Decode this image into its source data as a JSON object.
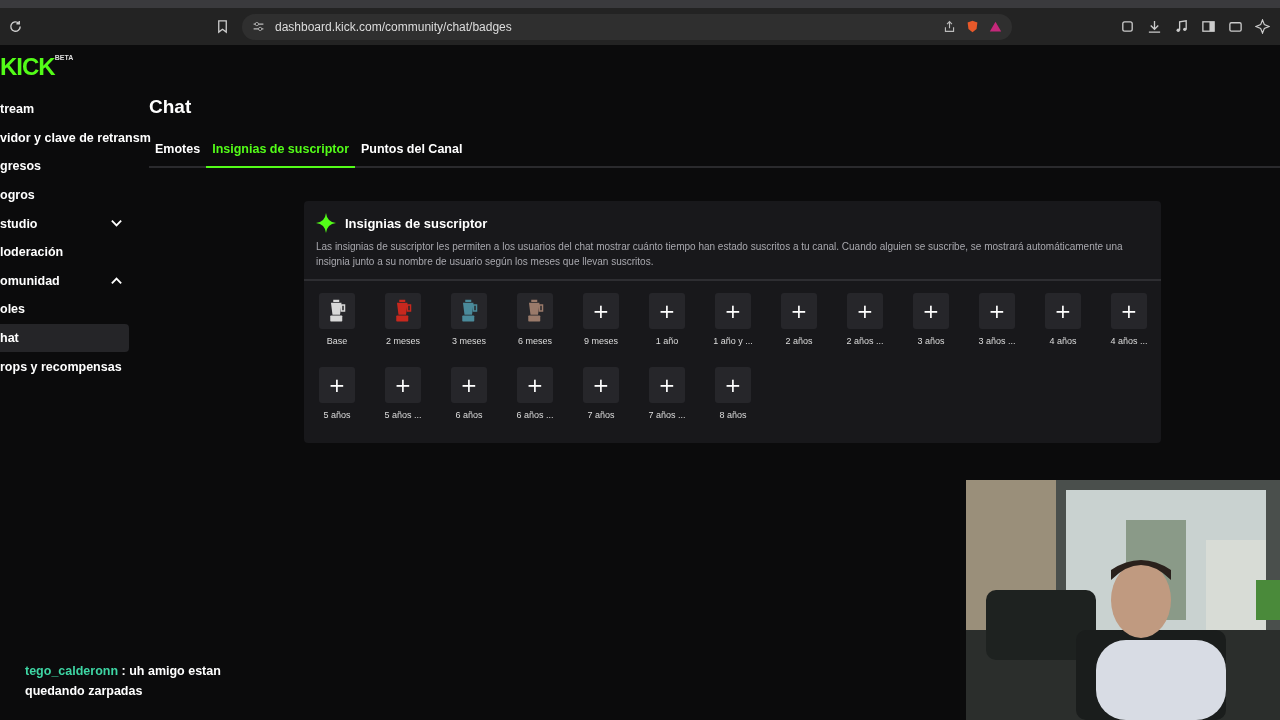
{
  "browser": {
    "url": "dashboard.kick.com/community/chat/badges"
  },
  "logo": {
    "text": "KICK",
    "tag": "BETA"
  },
  "sidebar": {
    "items": [
      {
        "label": "tream",
        "selected": false
      },
      {
        "label": "vidor y clave de retransm",
        "selected": false
      },
      {
        "label": "gresos",
        "selected": false
      },
      {
        "label": "ogros",
        "selected": false
      },
      {
        "label": "studio",
        "selected": false,
        "expanded": false
      },
      {
        "label": "loderación",
        "selected": false
      },
      {
        "label": "omunidad",
        "selected": false,
        "expanded": true
      },
      {
        "label": "oles",
        "selected": false
      },
      {
        "label": "hat",
        "selected": true
      },
      {
        "label": "rops y recompensas",
        "selected": false
      }
    ]
  },
  "page": {
    "title": "Chat"
  },
  "tabs": [
    {
      "label": "Emotes",
      "selected": false
    },
    {
      "label": "Insignias de suscriptor",
      "selected": true
    },
    {
      "label": "Puntos del Canal",
      "selected": false
    }
  ],
  "card": {
    "title": "Insignias de suscriptor",
    "description": "Las insignias de suscriptor les permiten a los usuarios del chat mostrar cuánto tiempo han estado suscritos a tu canal. Cuando alguien se suscribe, se mostrará automáticamente una insignia junto a su nombre de usuario según los meses que llevan suscritos.",
    "badges": [
      {
        "label": "Base",
        "color": "#d8d8d8"
      },
      {
        "label": "2 meses",
        "color": "#c8281e"
      },
      {
        "label": "3 meses",
        "color": "#4a8a9a"
      },
      {
        "label": "6 meses",
        "color": "#9a7a6a"
      },
      {
        "label": "9 meses",
        "kind": "add",
        "icon": "+"
      },
      {
        "label": "1 año",
        "kind": "add",
        "icon": "+"
      },
      {
        "label": "1 año y ...",
        "kind": "add",
        "icon": "+"
      },
      {
        "label": "2 años",
        "kind": "add",
        "icon": "+"
      },
      {
        "label": "2 años ...",
        "kind": "add",
        "icon": "+"
      },
      {
        "label": "3 años",
        "kind": "add",
        "icon": "+"
      },
      {
        "label": "3 años ...",
        "kind": "add",
        "icon": "+"
      },
      {
        "label": "4 años",
        "kind": "add",
        "icon": "+"
      },
      {
        "label": "4 años ...",
        "kind": "add",
        "icon": "+"
      },
      {
        "label": "5 años",
        "kind": "add",
        "icon": "+"
      },
      {
        "label": "5 años ...",
        "kind": "add",
        "icon": "+"
      },
      {
        "label": "6 años",
        "kind": "add",
        "icon": "+"
      },
      {
        "label": "6 años ...",
        "kind": "add",
        "icon": "+"
      },
      {
        "label": "7 años",
        "kind": "add",
        "icon": "+"
      },
      {
        "label": "7 años ...",
        "kind": "add",
        "icon": "+"
      },
      {
        "label": "8 años",
        "kind": "add",
        "icon": "+"
      }
    ]
  },
  "chat_overlay": {
    "user": "tego_calderonn",
    "separator": ":",
    "message": "uh amigo estan quedando zarpadas"
  }
}
